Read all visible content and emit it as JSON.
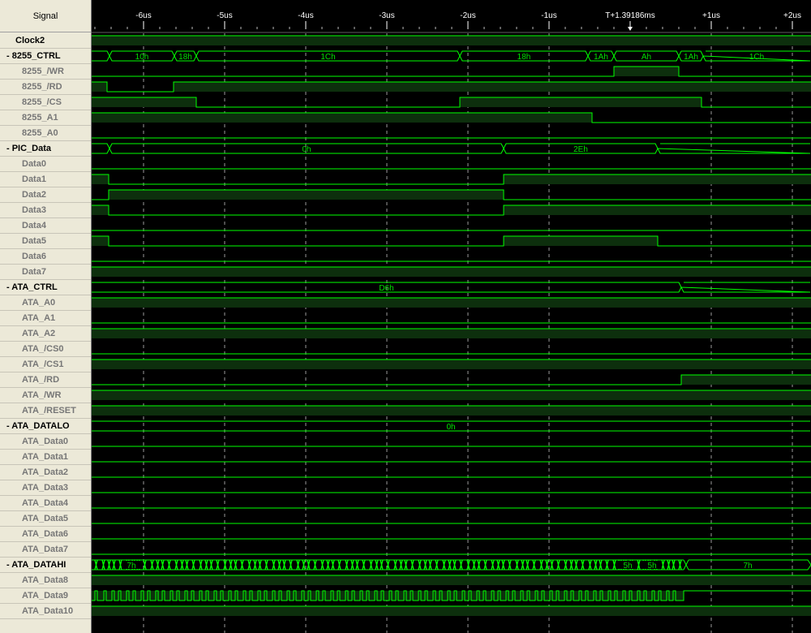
{
  "header": {
    "signal_label": "Signal"
  },
  "timebar": {
    "ticks": [
      {
        "label": "-6us",
        "t": -6
      },
      {
        "label": "-5us",
        "t": -5
      },
      {
        "label": "-4us",
        "t": -4
      },
      {
        "label": "-3us",
        "t": -3
      },
      {
        "label": "-2us",
        "t": -2
      },
      {
        "label": "-1us",
        "t": -1
      },
      {
        "label": "+1us",
        "t": 1
      },
      {
        "label": "+2us",
        "t": 2
      }
    ],
    "cursor_label": "T+1.39186ms",
    "visible_range_us": [
      -6.65,
      2.22
    ]
  },
  "colors": {
    "trace": "#00ff00",
    "trace_dim": "#00b000",
    "fill_high": "#0d2f0d",
    "background": "#000000",
    "grid": "#9a9a9a",
    "cursor_marker": "#ffffff"
  },
  "signals": [
    {
      "name": "Clock2",
      "kind": "top",
      "type": "const",
      "level": 1
    },
    {
      "name": "- 8255_CTRL",
      "kind": "group",
      "type": "bus",
      "segments": [
        {
          "from": -6.65,
          "to": -6.42,
          "label": ""
        },
        {
          "from": -6.42,
          "to": -5.62,
          "label": "10h"
        },
        {
          "from": -5.62,
          "to": -5.35,
          "label": "18h"
        },
        {
          "from": -5.35,
          "to": -2.1,
          "label": "1Ch"
        },
        {
          "from": -2.1,
          "to": -0.52,
          "label": "18h"
        },
        {
          "from": -0.52,
          "to": -0.2,
          "label": "1Ah"
        },
        {
          "from": -0.2,
          "to": 0.6,
          "label": "Ah"
        },
        {
          "from": 0.6,
          "to": 0.9,
          "label": "1Ah"
        },
        {
          "from": 0.9,
          "to": 2.22,
          "label": "1Ch"
        }
      ]
    },
    {
      "name": "8255_/WR",
      "kind": "child",
      "type": "digital",
      "initial": 0,
      "edges": [
        {
          "t": -0.2,
          "level": 1
        },
        {
          "t": 0.6,
          "level": 0
        }
      ]
    },
    {
      "name": "8255_/RD",
      "kind": "child",
      "type": "digital",
      "initial": 1,
      "edges": [
        {
          "t": -6.45,
          "level": 0
        },
        {
          "t": -5.63,
          "level": 1
        }
      ]
    },
    {
      "name": "8255_/CS",
      "kind": "child",
      "type": "digital",
      "initial": 1,
      "edges": [
        {
          "t": -5.35,
          "level": 0
        },
        {
          "t": -2.1,
          "level": 1
        },
        {
          "t": 0.88,
          "level": 0
        }
      ]
    },
    {
      "name": "8255_A1",
      "kind": "child",
      "type": "digital",
      "initial": 1,
      "edges": [
        {
          "t": -0.47,
          "level": 0
        }
      ]
    },
    {
      "name": "8255_A0",
      "kind": "child",
      "type": "const",
      "level": 0
    },
    {
      "name": "- PIC_Data",
      "kind": "group",
      "type": "bus",
      "segments": [
        {
          "from": -6.65,
          "to": -6.42,
          "label": ""
        },
        {
          "from": -6.42,
          "to": -1.56,
          "label": "0h"
        },
        {
          "from": -1.56,
          "to": 0.34,
          "label": "2Eh"
        },
        {
          "from": 0.34,
          "to": 2.22,
          "label": ""
        }
      ]
    },
    {
      "name": "Data0",
      "kind": "child",
      "type": "const",
      "level": 0
    },
    {
      "name": "Data1",
      "kind": "child",
      "type": "digital",
      "initial": 1,
      "edges": [
        {
          "t": -6.43,
          "level": 0
        },
        {
          "t": -1.56,
          "level": 1
        }
      ]
    },
    {
      "name": "Data2",
      "kind": "child",
      "type": "digital",
      "initial": 0,
      "edges": [
        {
          "t": -6.43,
          "level": 1
        },
        {
          "t": -1.56,
          "level": 0
        }
      ]
    },
    {
      "name": "Data3",
      "kind": "child",
      "type": "digital",
      "initial": 1,
      "edges": [
        {
          "t": -6.43,
          "level": 0
        },
        {
          "t": -1.56,
          "level": 1
        }
      ]
    },
    {
      "name": "Data4",
      "kind": "child",
      "type": "const",
      "level": 0
    },
    {
      "name": "Data5",
      "kind": "child",
      "type": "digital",
      "initial": 1,
      "edges": [
        {
          "t": -6.43,
          "level": 0
        },
        {
          "t": -1.56,
          "level": 1
        },
        {
          "t": 0.34,
          "level": 0
        }
      ]
    },
    {
      "name": "Data6",
      "kind": "child",
      "type": "const",
      "level": 0
    },
    {
      "name": "Data7",
      "kind": "child",
      "type": "const",
      "level": 1
    },
    {
      "name": "- ATA_CTRL",
      "kind": "group",
      "type": "bus",
      "segments": [
        {
          "from": -6.65,
          "to": 0.63,
          "label": "D6h"
        },
        {
          "from": 0.63,
          "to": 2.22,
          "label": ""
        }
      ]
    },
    {
      "name": "ATA_A0",
      "kind": "child",
      "type": "const",
      "level": 1
    },
    {
      "name": "ATA_A1",
      "kind": "child",
      "type": "const",
      "level": 0
    },
    {
      "name": "ATA_A2",
      "kind": "child",
      "type": "const",
      "level": 1
    },
    {
      "name": "ATA_/CS0",
      "kind": "child",
      "type": "const",
      "level": 0
    },
    {
      "name": "ATA_/CS1",
      "kind": "child",
      "type": "const",
      "level": 1
    },
    {
      "name": "ATA_/RD",
      "kind": "child",
      "type": "digital",
      "initial": 0,
      "edges": [
        {
          "t": 0.63,
          "level": 1
        }
      ]
    },
    {
      "name": "ATA_/WR",
      "kind": "child",
      "type": "const",
      "level": 1
    },
    {
      "name": "ATA_/RESET",
      "kind": "child",
      "type": "const",
      "level": 1
    },
    {
      "name": "- ATA_DATALO",
      "kind": "group",
      "type": "bus",
      "segments": [
        {
          "from": -6.65,
          "to": 2.22,
          "label": "0h"
        }
      ]
    },
    {
      "name": "ATA_Data0",
      "kind": "child",
      "type": "const",
      "level": 0
    },
    {
      "name": "ATA_Data1",
      "kind": "child",
      "type": "const",
      "level": 0
    },
    {
      "name": "ATA_Data2",
      "kind": "child",
      "type": "const",
      "level": 0
    },
    {
      "name": "ATA_Data3",
      "kind": "child",
      "type": "const",
      "level": 0
    },
    {
      "name": "ATA_Data4",
      "kind": "child",
      "type": "const",
      "level": 0
    },
    {
      "name": "ATA_Data5",
      "kind": "child",
      "type": "const",
      "level": 0
    },
    {
      "name": "ATA_Data6",
      "kind": "child",
      "type": "const",
      "level": 0
    },
    {
      "name": "ATA_Data7",
      "kind": "child",
      "type": "const",
      "level": 0
    },
    {
      "name": "- ATA_DATAHI",
      "kind": "group",
      "type": "busy",
      "labels": [
        {
          "t": -6.15,
          "label": "7h"
        },
        {
          "t": -0.03,
          "label": "5h"
        },
        {
          "t": 0.27,
          "label": "5h"
        },
        {
          "t": 1.45,
          "label": "7h"
        }
      ],
      "busy_from": -6.65,
      "busy_to": 0.66
    },
    {
      "name": "ATA_Data8",
      "kind": "child",
      "type": "const",
      "level": 1
    },
    {
      "name": "ATA_Data9",
      "kind": "child",
      "type": "pulses",
      "from": -6.65,
      "to": 0.66
    },
    {
      "name": "ATA_Data10",
      "kind": "child",
      "type": "const",
      "level": 1
    }
  ]
}
